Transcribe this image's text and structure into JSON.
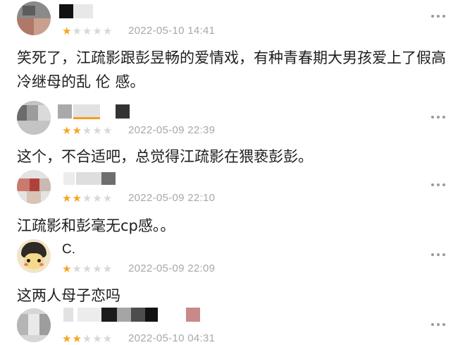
{
  "comments": [
    {
      "username": "",
      "rating": 1,
      "date": "2022-05-10 14:41",
      "text": "笑死了，江疏影跟彭昱畅的爱情戏，有种青春期大男孩爱上了假高冷继母的乱 伦 感。"
    },
    {
      "username": "",
      "rating": 2,
      "date": "2022-05-09 22:39",
      "text": "这个，不合适吧，总觉得江疏影在猥亵彭彭。"
    },
    {
      "username": "",
      "rating": 2,
      "date": "2022-05-09 22:10",
      "text": "江疏影和彭毫无cp感。。"
    },
    {
      "username": "C.",
      "rating": 1,
      "date": "2022-05-09 22:09",
      "text": "这两人母子恋吗"
    },
    {
      "username": "",
      "rating": 2,
      "date": "2022-05-10 04:31",
      "text": ""
    }
  ],
  "icons": {
    "more": "more-dots-icon",
    "star": "star-icon"
  },
  "colors": {
    "star_on": "#f5a623",
    "star_off": "#d8d8d8",
    "date": "#a8a8a8"
  }
}
